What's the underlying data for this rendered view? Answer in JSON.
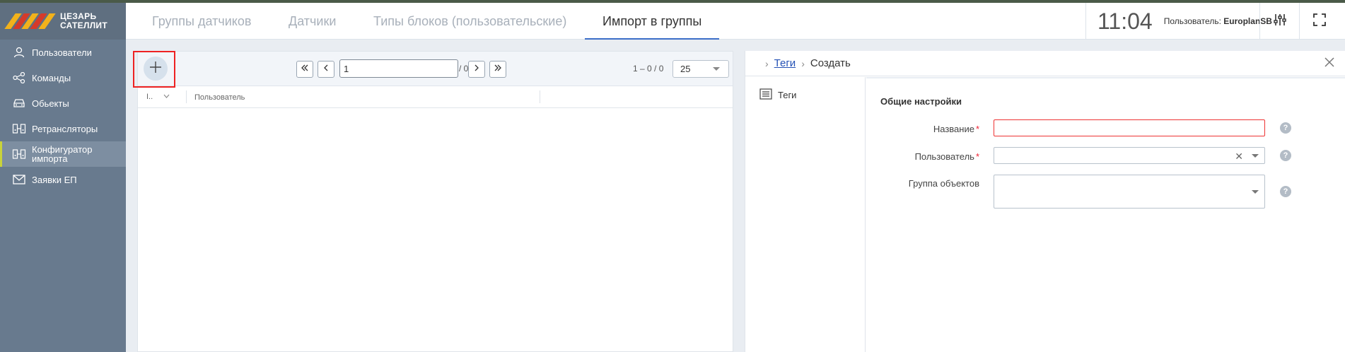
{
  "logo": {
    "line1": "ЦЕЗАРЬ",
    "line2": "САТЕЛЛИТ"
  },
  "sidebar": {
    "items": [
      {
        "label": "Пользователи",
        "icon": "user-icon"
      },
      {
        "label": "Команды",
        "icon": "share-icon"
      },
      {
        "label": "Обьекты",
        "icon": "car-icon"
      },
      {
        "label": "Ретрансляторы",
        "icon": "relay-icon"
      },
      {
        "label": "Конфигуратор\nимпорта",
        "icon": "relay-icon",
        "active": true
      },
      {
        "label": "Заявки ЕП",
        "icon": "mail-icon"
      }
    ]
  },
  "header": {
    "tabs": [
      {
        "label": "Группы датчиков"
      },
      {
        "label": "Датчики"
      },
      {
        "label": "Типы блоков (пользовательские)"
      },
      {
        "label": "Импорт в группы",
        "active": true
      }
    ],
    "time": "11:04",
    "user_prefix": "Пользователь:",
    "user_name": "EuroplanSB"
  },
  "list": {
    "page_value": "1",
    "page_total": "/ 0",
    "range": "1 – 0 / 0",
    "per_page": "25",
    "columns": [
      "I..",
      "Пользователь"
    ]
  },
  "detail": {
    "breadcrumb_link": "Теги",
    "breadcrumb_current": "Создать",
    "side_item": "Теги",
    "section_title": "Общие настройки",
    "fields": {
      "name_label": "Название",
      "user_label": "Пользователь",
      "group_label": "Группа объектов",
      "required_mark": "*",
      "help_mark": "?"
    }
  },
  "colors": {
    "accent": "#3c6ec8",
    "error": "#e22222",
    "sidebar": "#687a8e"
  }
}
